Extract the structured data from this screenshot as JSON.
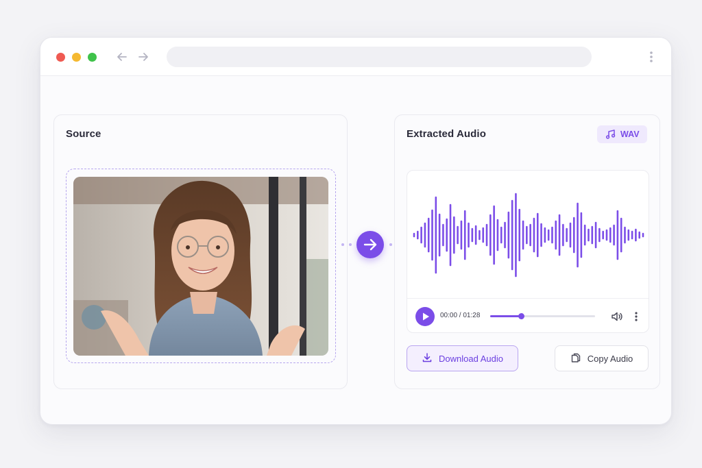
{
  "colors": {
    "accent": "#7b4de8",
    "accent_light": "#f4effe",
    "traffic_red": "#ef5a52",
    "traffic_yellow": "#f5b931",
    "traffic_green": "#3fc24a"
  },
  "browser": {
    "icons": [
      "arrow-left-icon",
      "arrow-right-icon",
      "kebab-menu-icon"
    ]
  },
  "source_panel": {
    "title": "Source"
  },
  "audio_panel": {
    "title": "Extracted Audio",
    "format_badge": {
      "icon": "music-note-icon",
      "label": "WAV"
    },
    "player": {
      "time": "00:00 / 01:28",
      "progress": 0.3,
      "icons": [
        "play-icon",
        "volume-icon",
        "more-vertical-icon"
      ]
    },
    "actions": {
      "download_label": "Download Audio",
      "download_icon": "download-icon",
      "copy_label": "Copy Audio",
      "copy_icon": "copy-icon"
    }
  }
}
